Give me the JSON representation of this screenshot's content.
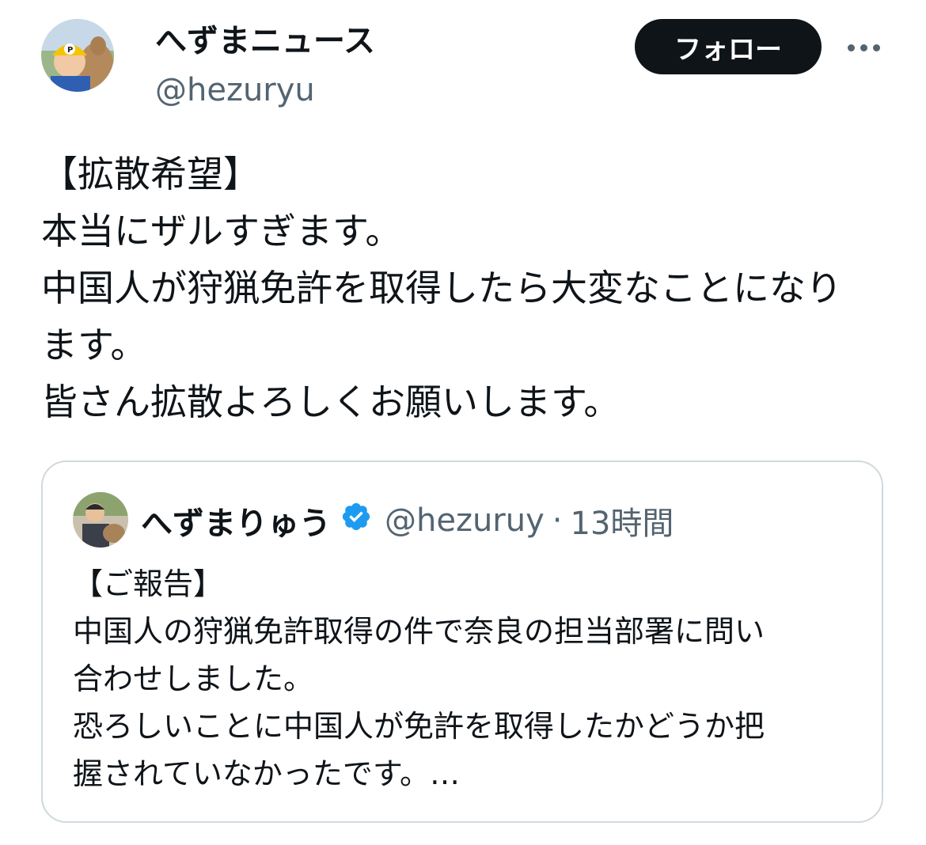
{
  "author": {
    "display_name": "へずまニュース",
    "handle": "@hezuryu"
  },
  "actions": {
    "follow_label": "フォロー",
    "more_icon": "more-horizontal-icon"
  },
  "post": {
    "lines": [
      "【拡散希望】",
      "本当にザルすぎます。",
      "中国人が狩猟免許を取得したら大変なことになり",
      "ます。",
      "皆さん拡散よろしくお願いします。"
    ]
  },
  "quote": {
    "display_name": "へずまりゅう",
    "verified_icon": "verified-badge-icon",
    "handle": "@hezuruy",
    "separator": "·",
    "time": "13時間",
    "lines": [
      "【ご報告】",
      "中国人の狩猟免許取得の件で奈良の担当部署に問い",
      "合わせしました。",
      "恐ろしいことに中国人が免許を取得したかどうか把",
      "握されていなかったです。…"
    ]
  },
  "colors": {
    "text_primary": "#0f1419",
    "text_secondary": "#536471",
    "border": "#cfd9de",
    "verified": "#1d9bf0",
    "button_bg": "#0f1419"
  }
}
